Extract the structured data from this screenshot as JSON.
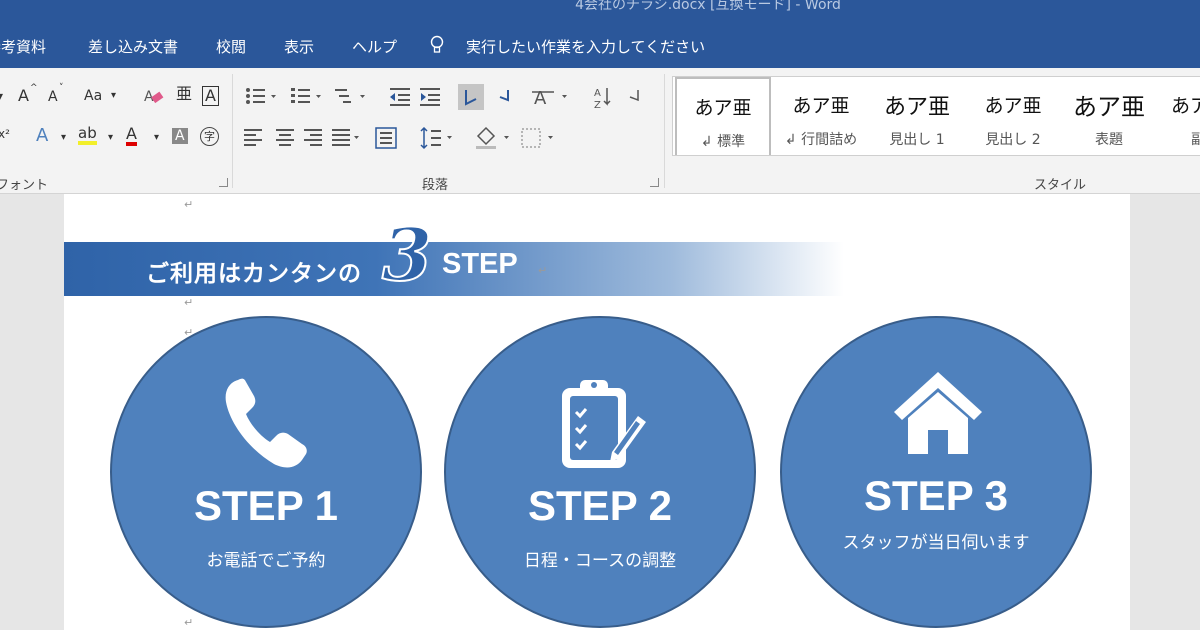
{
  "window": {
    "title": "4会社のチラシ.docx [互換モード]  -  Word"
  },
  "tabs": [
    "参考資料",
    "差し込み文書",
    "校閲",
    "表示",
    "ヘルプ"
  ],
  "tell_me": "実行したい作業を入力してください",
  "ribbon": {
    "font_group_label": "フォント",
    "paragraph_group_label": "段落",
    "styles_group_label": "スタイル",
    "font_buttons": {
      "grow": "A",
      "shrink": "A",
      "change_case": "Aa",
      "phonetic": "亜",
      "char_border": "A",
      "text_effect": "A",
      "highlight": "ab",
      "font_color": "A",
      "char_shading": "A",
      "enclose": "字"
    },
    "styles": [
      {
        "sample": "あア亜",
        "name": "↲ 標準"
      },
      {
        "sample": "あア亜",
        "name": "↲ 行間詰め"
      },
      {
        "sample": "あア亜",
        "name": "見出し 1"
      },
      {
        "sample": "あア亜",
        "name": "見出し 2"
      },
      {
        "sample": "あア亜",
        "name": "表題"
      },
      {
        "sample": "あア",
        "name": "副"
      }
    ]
  },
  "document": {
    "paragraph_mark": "↵",
    "banner": {
      "lead": "ご利用はカンタンの",
      "number": "3",
      "word": "STEP"
    },
    "steps": [
      {
        "title": "STEP 1",
        "desc": "お電話でご予約",
        "icon": "phone-icon"
      },
      {
        "title": "STEP 2",
        "desc": "日程・コースの調整",
        "icon": "clipboard-checklist-icon"
      },
      {
        "title": "STEP 3",
        "desc": "スタッフが当日伺います",
        "icon": "house-icon"
      }
    ]
  },
  "colors": {
    "ribbon_blue": "#2b579a",
    "circle_fill": "#4f81bd",
    "circle_border": "#385d8a"
  }
}
